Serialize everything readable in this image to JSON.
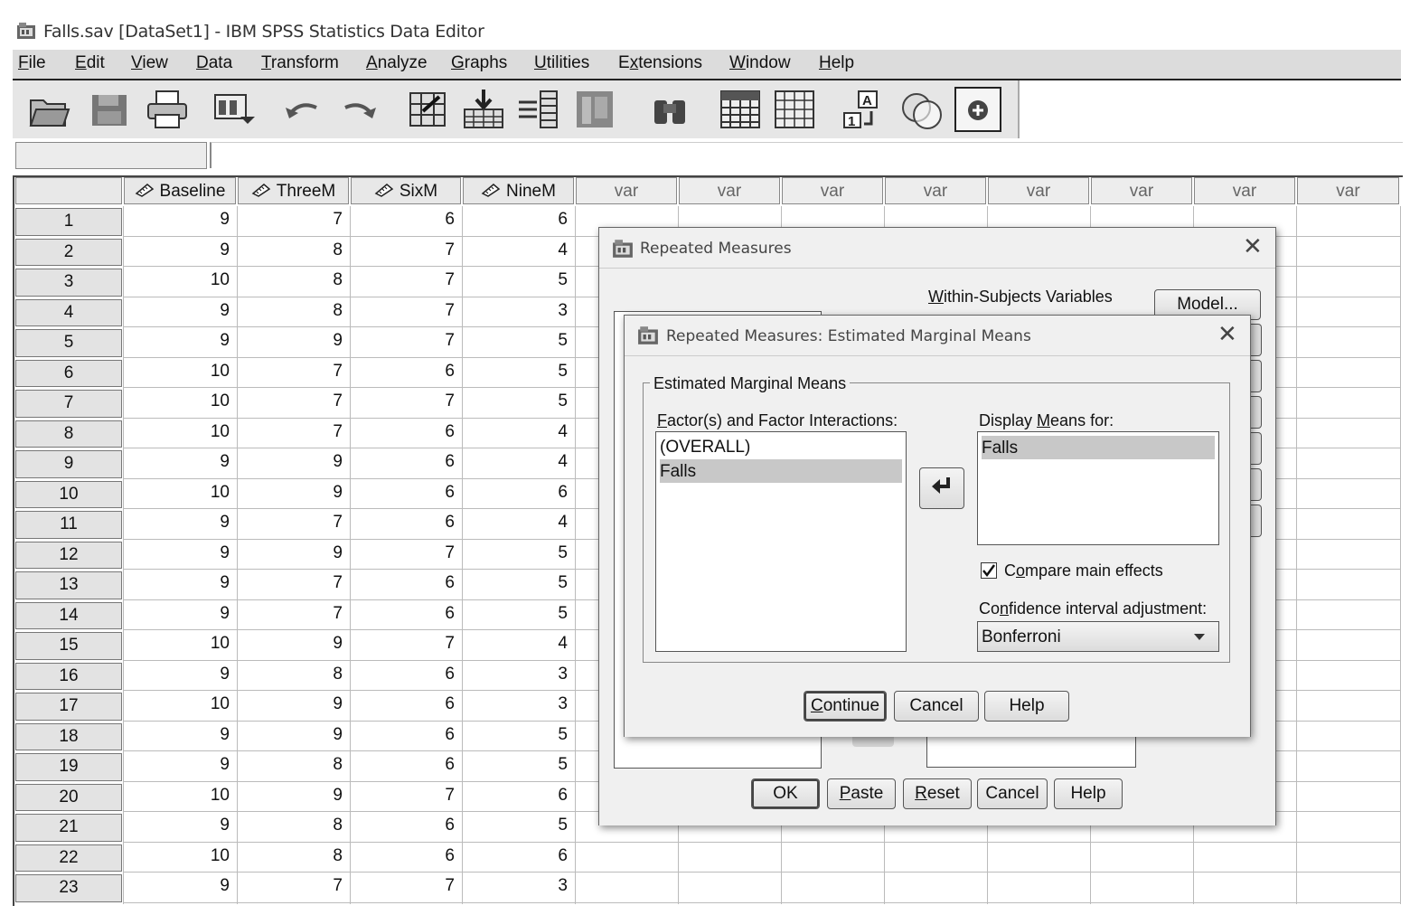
{
  "window": {
    "title": "Falls.sav [DataSet1] - IBM SPSS Statistics Data Editor"
  },
  "menu": [
    {
      "label": "File",
      "u": "F"
    },
    {
      "label": "Edit",
      "u": "E"
    },
    {
      "label": "View",
      "u": "V"
    },
    {
      "label": "Data",
      "u": "D"
    },
    {
      "label": "Transform",
      "u": "T"
    },
    {
      "label": "Analyze",
      "u": "A"
    },
    {
      "label": "Graphs",
      "u": "G"
    },
    {
      "label": "Utilities",
      "u": "U"
    },
    {
      "label": "Extensions",
      "u": "x"
    },
    {
      "label": "Window",
      "u": "W"
    },
    {
      "label": "Help",
      "u": "H"
    }
  ],
  "toolbar": [
    "open-icon",
    "save-icon",
    "print-icon",
    "dialog-recall-icon",
    "undo-icon",
    "redo-icon",
    "goto-case-icon",
    "goto-variable-icon",
    "variables-icon",
    "run-descriptives-icon",
    "find-icon",
    "insert-cases-icon",
    "insert-variable-icon",
    "split-file-icon",
    "weight-cases-icon",
    "select-cases-icon",
    "value-labels-icon"
  ],
  "grid": {
    "columns": [
      "Baseline",
      "ThreeM",
      "SixM",
      "NineM"
    ],
    "var_label": "var",
    "rows": [
      [
        1,
        9,
        7,
        6,
        6
      ],
      [
        2,
        9,
        8,
        7,
        4
      ],
      [
        3,
        10,
        8,
        7,
        5
      ],
      [
        4,
        9,
        8,
        7,
        3
      ],
      [
        5,
        9,
        9,
        7,
        5
      ],
      [
        6,
        10,
        7,
        6,
        5
      ],
      [
        7,
        10,
        7,
        7,
        5
      ],
      [
        8,
        10,
        7,
        6,
        4
      ],
      [
        9,
        9,
        9,
        6,
        4
      ],
      [
        10,
        10,
        9,
        6,
        6
      ],
      [
        11,
        9,
        7,
        6,
        4
      ],
      [
        12,
        9,
        9,
        7,
        5
      ],
      [
        13,
        9,
        7,
        6,
        5
      ],
      [
        14,
        9,
        7,
        6,
        5
      ],
      [
        15,
        10,
        9,
        7,
        4
      ],
      [
        16,
        9,
        8,
        6,
        3
      ],
      [
        17,
        10,
        9,
        6,
        3
      ],
      [
        18,
        9,
        9,
        6,
        5
      ],
      [
        19,
        9,
        8,
        6,
        5
      ],
      [
        20,
        10,
        9,
        7,
        6
      ],
      [
        21,
        9,
        8,
        6,
        5
      ],
      [
        22,
        10,
        8,
        6,
        6
      ],
      [
        23,
        9,
        7,
        7,
        3
      ]
    ]
  },
  "rm_dialog": {
    "title": "Repeated Measures",
    "within_label": "Within-Subjects Variables",
    "model_button": "Model...",
    "buttons": {
      "ok": "OK",
      "paste": "Paste",
      "reset": "Reset",
      "cancel": "Cancel",
      "help": "Help"
    }
  },
  "emm_dialog": {
    "title": "Repeated Measures: Estimated Marginal Means",
    "group_title": "Estimated Marginal Means",
    "factors_label": "Factor(s) and Factor Interactions:",
    "factors": [
      "(OVERALL)",
      "Falls"
    ],
    "display_label": "Display Means for:",
    "display_items": [
      "Falls"
    ],
    "compare_label": "Compare main effects",
    "compare_checked": true,
    "ci_label": "Confidence interval adjustment:",
    "ci_value": "Bonferroni",
    "buttons": {
      "continue": "Continue",
      "cancel": "Cancel",
      "help": "Help"
    }
  }
}
